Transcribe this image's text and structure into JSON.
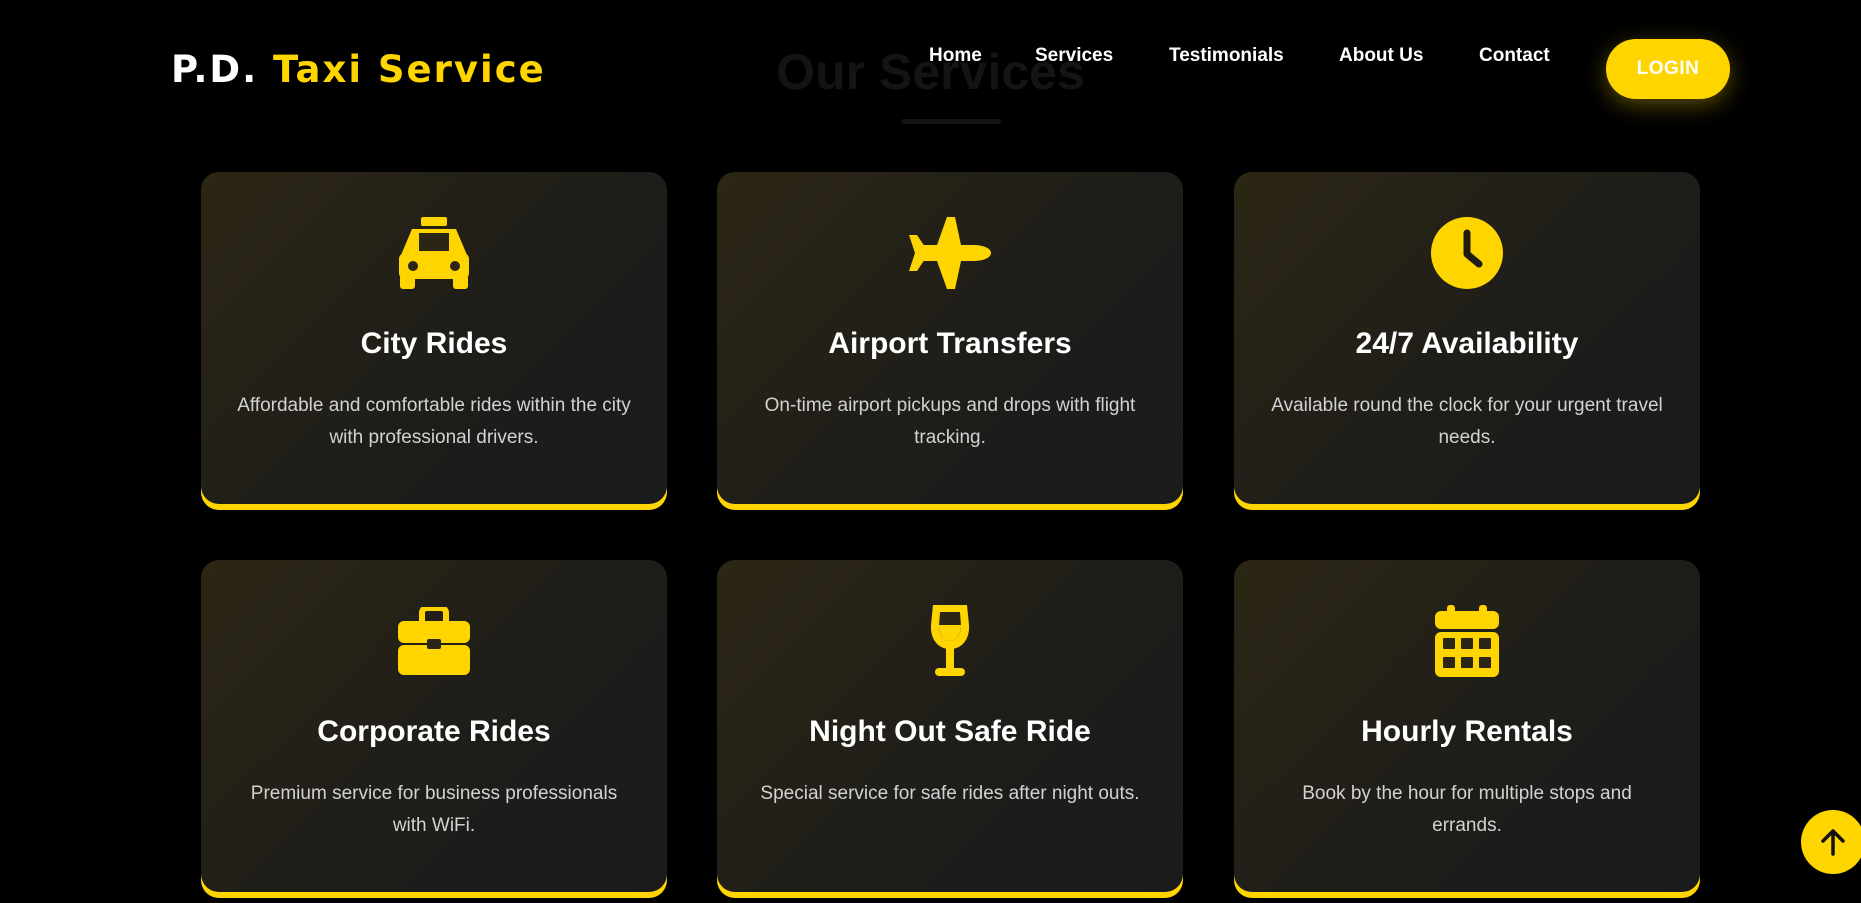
{
  "brand": {
    "part1": "P.D.",
    "part2": "Taxi Service"
  },
  "nav": {
    "items": [
      {
        "label": "Home"
      },
      {
        "label": "Services"
      },
      {
        "label": "Testimonials"
      },
      {
        "label": "About Us"
      },
      {
        "label": "Contact"
      }
    ],
    "login_label": "LOGIN"
  },
  "section": {
    "title": "Our Services"
  },
  "services": [
    {
      "icon": "taxi-icon",
      "title": "City Rides",
      "description": "Affordable and comfortable rides within the city with professional drivers."
    },
    {
      "icon": "plane-icon",
      "title": "Airport Transfers",
      "description": "On-time airport pickups and drops with flight tracking."
    },
    {
      "icon": "clock-icon",
      "title": "24/7 Availability",
      "description": "Available round the clock for your urgent travel needs."
    },
    {
      "icon": "briefcase-icon",
      "title": "Corporate Rides",
      "description": "Premium service for business professionals with WiFi."
    },
    {
      "icon": "wine-glass-icon",
      "title": "Night Out Safe Ride",
      "description": "Special service for safe rides after night outs."
    },
    {
      "icon": "calendar-icon",
      "title": "Hourly Rentals",
      "description": "Book by the hour for multiple stops and errands."
    }
  ],
  "scroll_top": {
    "icon": "arrow-up-icon"
  },
  "colors": {
    "accent": "#ffd500",
    "background": "#000000",
    "card": "#1e1d19",
    "text": "#ffffff",
    "muted_text": "#d2d2d2"
  }
}
